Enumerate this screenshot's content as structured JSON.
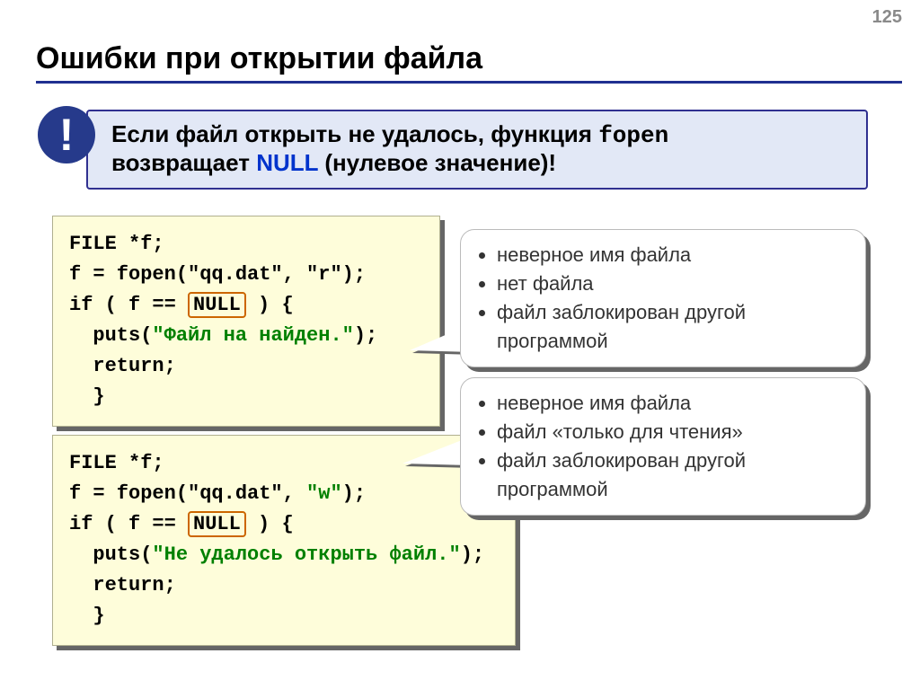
{
  "page_number": "125",
  "title": "Ошибки при открытии файла",
  "warning": {
    "badge": "!",
    "line1a": " Если файл открыть не удалось, функция ",
    "fopen": "fopen",
    "line2a": " возвращает ",
    "null_word": "NULL",
    "line2b": " (нулевое значение)!"
  },
  "code1": {
    "l1": "FILE *f;",
    "l2": "f = fopen(\"qq.dat\", \"r\");",
    "l3a": "if ( f == ",
    "l3_null": "NULL",
    "l3b": " ) {",
    "l4a": "  puts(",
    "l4s": "\"Файл на найден.\"",
    "l4b": ");",
    "l5": "  return;",
    "l6": "  }"
  },
  "callout1": {
    "0": "неверное имя файла",
    "1": "нет файла",
    "2": "файл заблокирован другой программой"
  },
  "code2": {
    "l1": "FILE *f;",
    "l2a": "f = fopen(\"qq.dat\", ",
    "l2w": "\"w\"",
    "l2b": ");",
    "l3a": "if ( f == ",
    "l3_null": "NULL",
    "l3b": " ) {",
    "l4a": "  puts(",
    "l4s": "\"Не удалось открыть файл.\"",
    "l4b": ");",
    "l5": "  return;",
    "l6": "  }"
  },
  "callout2": {
    "0": "неверное имя файла",
    "1": "файл «только для чтения»",
    "2": "файл заблокирован другой программой"
  }
}
